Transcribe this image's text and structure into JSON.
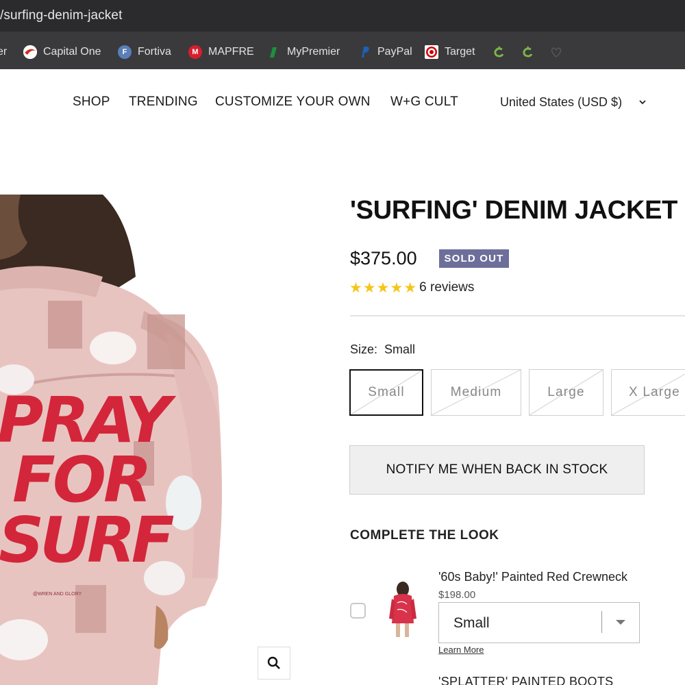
{
  "browser": {
    "url_fragment": "/surfing-denim-jacket",
    "bookmarks": [
      {
        "label": "er",
        "icon": "bookmark-partial-icon",
        "color": "#888888"
      },
      {
        "label": "Capital One",
        "icon": "capital-one-icon",
        "color": "#d22e1e"
      },
      {
        "label": "Fortiva",
        "icon": "fortiva-icon",
        "color": "#5a7fb8"
      },
      {
        "label": "MAPFRE",
        "icon": "mapfre-icon",
        "color": "#d81e2c"
      },
      {
        "label": "MyPremier",
        "icon": "mypremier-icon",
        "color": "#1d8f3c"
      },
      {
        "label": "PayPal",
        "icon": "paypal-icon",
        "color": "#1f5fb4"
      },
      {
        "label": "Target",
        "icon": "target-icon",
        "color": "#cc0000"
      }
    ]
  },
  "nav": {
    "items": [
      "SHOP",
      "TRENDING",
      "CUSTOMIZE YOUR OWN",
      "W+G CULT"
    ],
    "currency": "United States (USD $)"
  },
  "product": {
    "title": "'SURFING' DENIM JACKET",
    "price": "$375.00",
    "badge": "SOLD OUT",
    "rating": 5,
    "reviews": "6 reviews",
    "size_label": "Size:",
    "size_value": "Small",
    "sizes": [
      "Small",
      "Medium",
      "Large",
      "X Large"
    ],
    "selected_size": "Small",
    "notify_label": "NOTIFY ME WHEN BACK IN STOCK",
    "jacket_text": [
      "PRAY",
      "FOR",
      "SURF"
    ],
    "jacket_tag": "@WREN AND GLORY"
  },
  "complete_the_look": {
    "heading": "COMPLETE THE LOOK",
    "item": {
      "name": "'60s Baby!' Painted Red Crewneck",
      "price": "$198.00",
      "selected": "Small",
      "learn_more": "Learn More"
    },
    "next_item": "'SPLATTER' PAINTED BOOTS"
  },
  "colors": {
    "accent_badge": "#6d6f9a",
    "star": "#f5c518",
    "jacket": "#e8c4c1",
    "paint": "#d3263a"
  }
}
